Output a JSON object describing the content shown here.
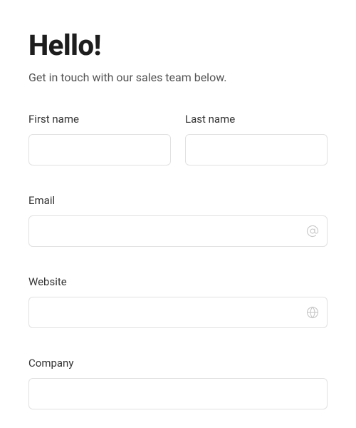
{
  "header": {
    "title": "Hello!",
    "subtitle": "Get in touch with our sales team below."
  },
  "form": {
    "first_name": {
      "label": "First name",
      "value": ""
    },
    "last_name": {
      "label": "Last name",
      "value": ""
    },
    "email": {
      "label": "Email",
      "value": "",
      "icon": "at-icon"
    },
    "website": {
      "label": "Website",
      "value": "",
      "icon": "globe-icon"
    },
    "company": {
      "label": "Company",
      "value": ""
    }
  }
}
